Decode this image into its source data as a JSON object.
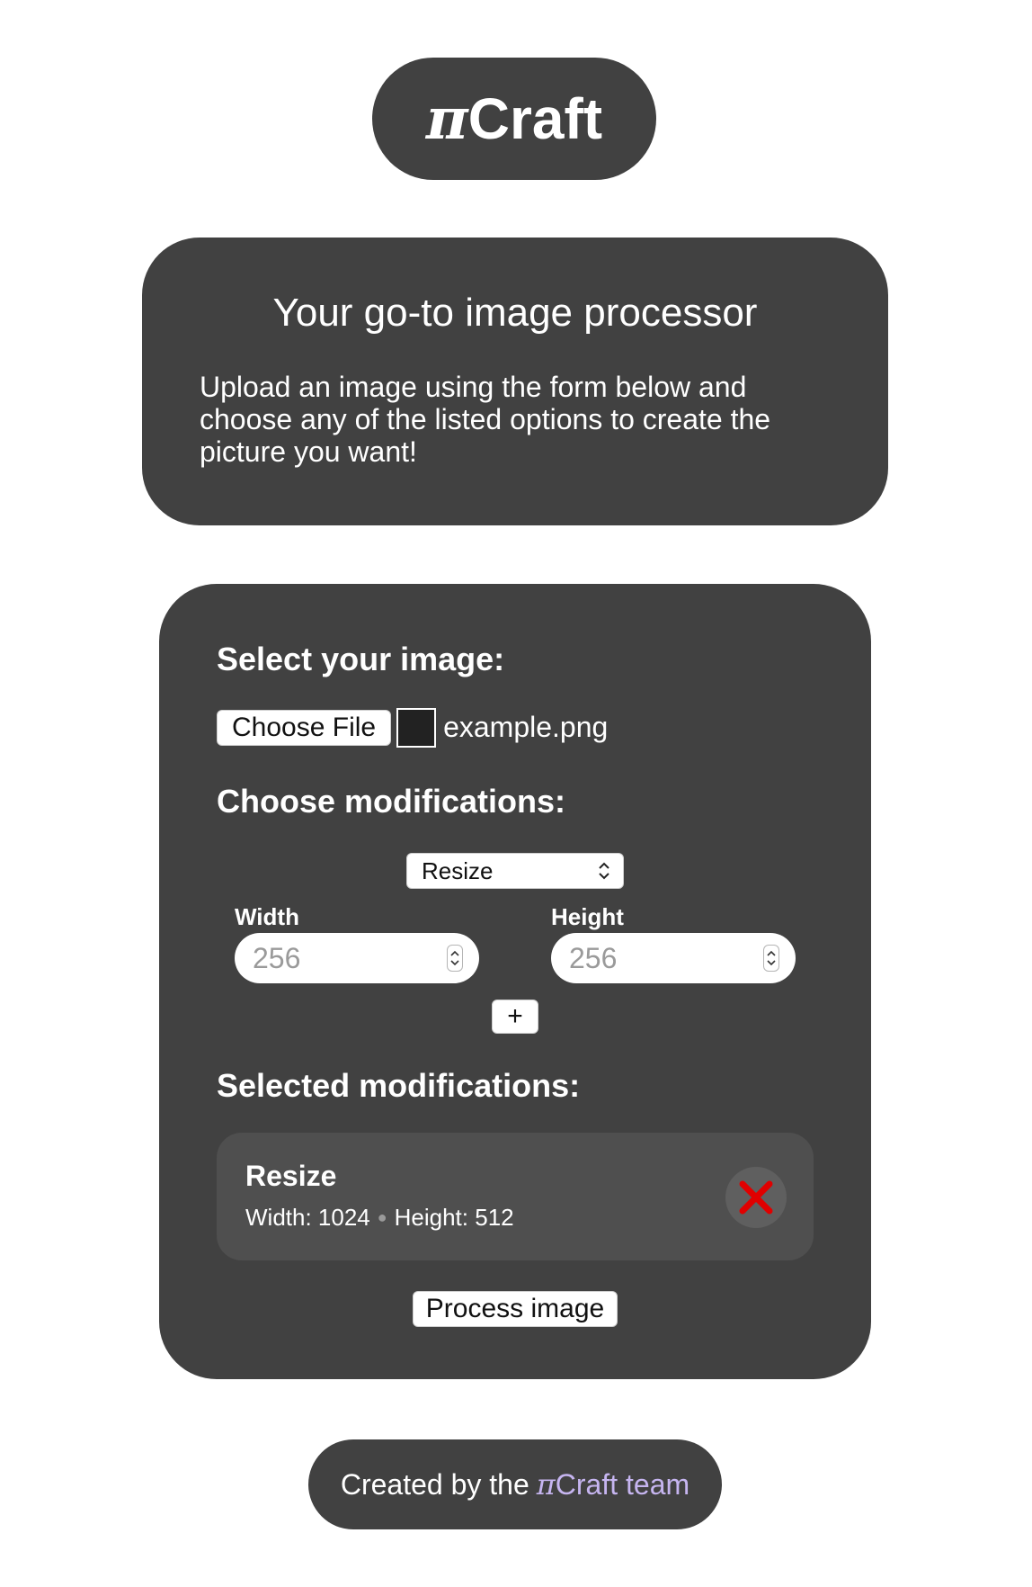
{
  "logo": {
    "pi": "π",
    "name": "Craft"
  },
  "intro": {
    "title": "Your go-to image processor",
    "description": "Upload an image using the form below and choose any of the listed options to create the picture you want!"
  },
  "form": {
    "select_image_title": "Select your image:",
    "choose_file_label": "Choose File",
    "file_name": "example.png",
    "modifications_title": "Choose modifications:",
    "modification_select": {
      "selected": "Resize"
    },
    "width_field": {
      "label": "Width",
      "placeholder": "256"
    },
    "height_field": {
      "label": "Height",
      "placeholder": "256"
    },
    "add_label": "+",
    "selected_title": "Selected modifications:",
    "selected_modifications": [
      {
        "name": "Resize",
        "width_text": "Width: 1024",
        "height_text": "Height: 512"
      }
    ],
    "process_label": "Process image"
  },
  "footer": {
    "prefix": "Created by the",
    "link_pi": "π",
    "link_text": "Craft team"
  },
  "colors": {
    "card_bg": "#414141",
    "item_bg": "#4f4f4f",
    "link": "#c6b5f0",
    "remove_icon": "#e00000"
  }
}
